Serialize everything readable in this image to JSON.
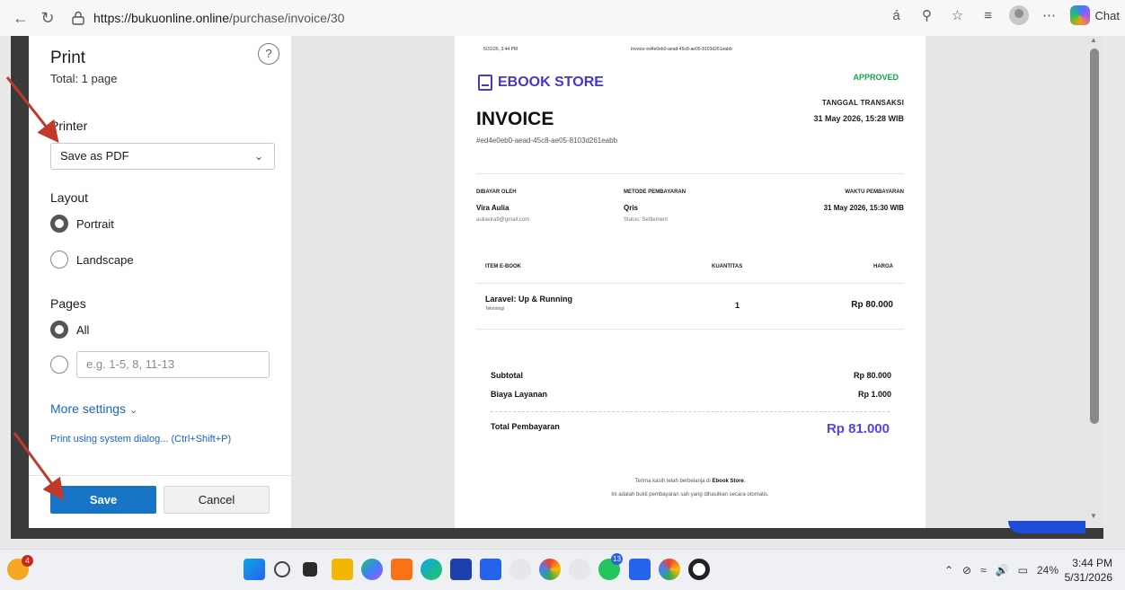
{
  "browser": {
    "url_host": "https://bukuonline.online",
    "url_path": "/purchase/invoice/30",
    "chat_label": "Chat"
  },
  "print": {
    "title": "Print",
    "total": "Total: 1 page",
    "help": "?",
    "printer_label": "Printer",
    "printer_value": "Save as PDF",
    "layout_label": "Layout",
    "portrait": "Portrait",
    "landscape": "Landscape",
    "pages_label": "Pages",
    "pages_all": "All",
    "pages_placeholder": "e.g. 1-5, 8, 11-13",
    "more_settings": "More settings",
    "system_dialog": "Print using system dialog... (Ctrl+Shift+P)",
    "save": "Save",
    "cancel": "Cancel"
  },
  "invoice": {
    "header_date": "5/31/26, 3:44 PM",
    "header_title": "Invoice ed4e0eb0-aead-45c8-ae05-8103d261eabb",
    "brand": "EBOOK STORE",
    "status": "APPROVED",
    "title": "INVOICE",
    "id": "#ed4e0eb0-aead-45c8-ae05-8103d261eabb",
    "date_label": "TANGGAL TRANSAKSI",
    "date_value": "31 May 2026, 15:28 WIB",
    "paid_by_label": "DIBAYAR OLEH",
    "paid_by_name": "Vira Aulia",
    "paid_by_email": "auliavira9@gmail.com",
    "method_label": "METODE PEMBAYARAN",
    "method_value": "Qris",
    "method_status": "Status: Settlement",
    "time_label": "WAKTU PEMBAYARAN",
    "time_value": "31 May 2026, 15:30 WIB",
    "col_item": "ITEM E-BOOK",
    "col_qty": "KUANTITAS",
    "col_price": "HARGA",
    "item_title": "Laravel: Up & Running",
    "item_category": "Teknologi",
    "item_qty": "1",
    "item_price": "Rp 80.000",
    "subtotal_label": "Subtotal",
    "subtotal_value": "Rp 80.000",
    "fee_label": "Biaya Layanan",
    "fee_value": "Rp 1.000",
    "total_label": "Total Pembayaran",
    "total_value": "Rp 81.000",
    "footer_thanks_pre": "Terima kasih telah berbelanja di",
    "footer_thanks_store": "Ebook Store",
    "footer_note": "Ini adalah bukti pembayaran sah yang dihasilkan secara otomatis."
  },
  "taskbar": {
    "badge_left": "4",
    "badge_whatsapp": "13",
    "battery": "24%",
    "time": "3:44 PM",
    "date": "5/31/2026"
  },
  "colors": {
    "accent": "#1874c5",
    "brand": "#4338ca",
    "approved": "#16a34a",
    "total": "#4f46e5",
    "arrow": "#c0392b"
  }
}
